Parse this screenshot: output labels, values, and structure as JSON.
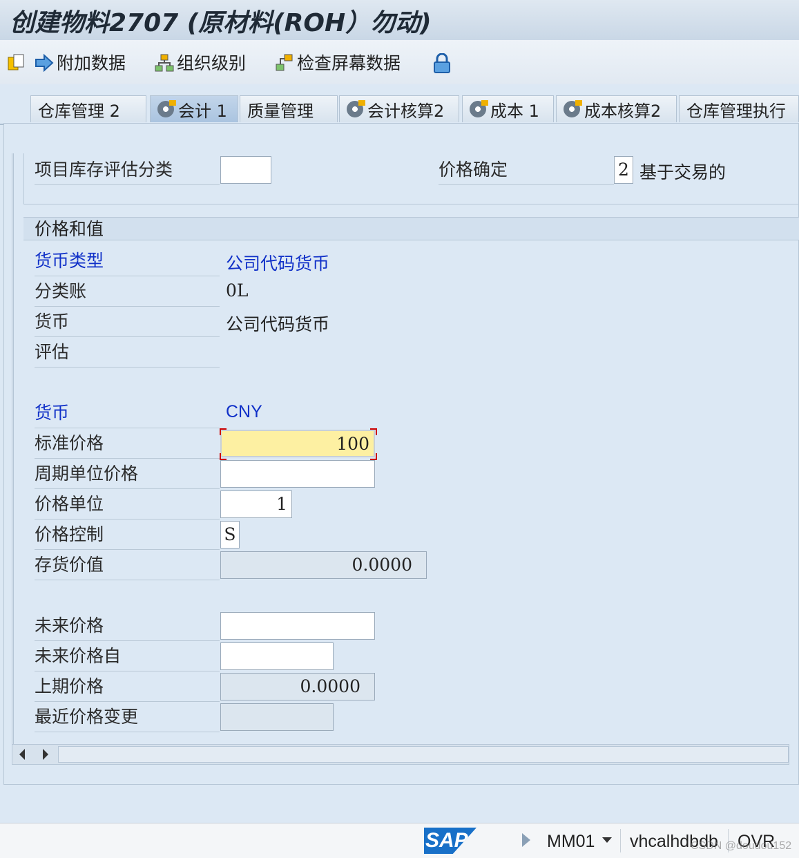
{
  "window": {
    "title": "创建物料2707 (原材料(ROH）勿动)"
  },
  "toolbar": {
    "additional_data": "附加数据",
    "org_levels": "组织级别",
    "check_screen_data": "检查屏幕数据"
  },
  "tabs": [
    {
      "label": "仓库管理 2"
    },
    {
      "label": "会计 1"
    },
    {
      "label": "质量管理"
    },
    {
      "label": "会计核算2"
    },
    {
      "label": "成本 1"
    },
    {
      "label": "成本核算2"
    },
    {
      "label": "仓库管理执行"
    }
  ],
  "header_fields": {
    "valuation_category_label": "项目库存评估分类",
    "valuation_category_value": "",
    "price_determination_label": "价格确定",
    "price_determination_value": "2",
    "price_determination_text": "基于交易的"
  },
  "prices": {
    "section_title": "价格和值",
    "currency_type_label": "货币类型",
    "currency_type_value": "公司代码货币",
    "ledger_label": "分类账",
    "ledger_value": "0L",
    "currency_label": "货币",
    "currency_value": "公司代码货币",
    "valuation_label": "评估",
    "currency2_label": "货币",
    "currency2_value": "CNY",
    "standard_price_label": "标准价格",
    "standard_price_value": "100",
    "periodic_unit_price_label": "周期单位价格",
    "periodic_unit_price_value": "",
    "price_unit_label": "价格单位",
    "price_unit_value": "1",
    "price_control_label": "价格控制",
    "price_control_value": "S",
    "inventory_value_label": "存货价值",
    "inventory_value_value": "0.0000",
    "future_price_label": "未来价格",
    "future_price_value": "",
    "future_price_from_label": "未来价格自",
    "future_price_from_value": "",
    "previous_price_label": "上期价格",
    "previous_price_value": "0.0000",
    "last_price_change_label": "最近价格变更",
    "last_price_change_value": ""
  },
  "statusbar": {
    "logo": "SAP",
    "transaction": "MM01",
    "server": "vhcalhdbdb",
    "mode": "OVR",
    "watermark": "CSDN @doudou152"
  },
  "colors": {
    "label_blue": "#1030c8",
    "focus_yellow": "#fdf0a2",
    "background": "#dce8f4"
  }
}
